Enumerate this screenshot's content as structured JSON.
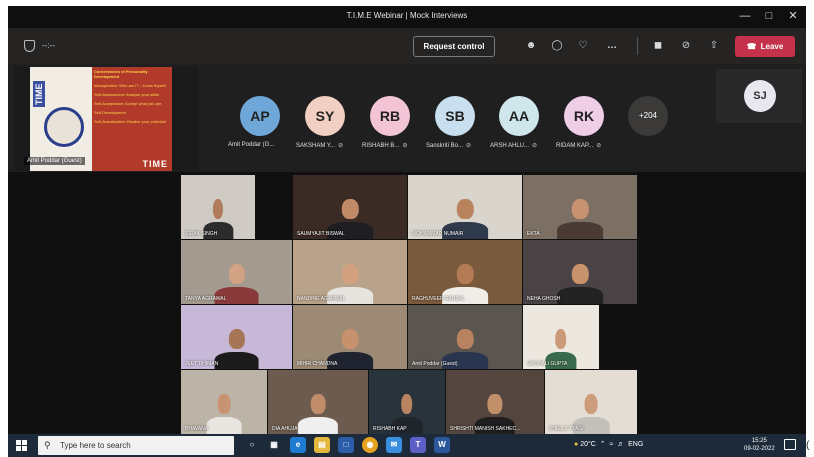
{
  "window": {
    "title": "T.I.M.E Webinar | Mock Interviews"
  },
  "toolbar": {
    "timer": "--:--",
    "request_control": "Request control",
    "leave": "Leave"
  },
  "shared_screen": {
    "owner": "Amit Poddar (Guest)",
    "side_text": "TIME",
    "brand": "TIME",
    "bullets": [
      "Cornerstones of Personality Development",
      "Introspection: Who am I? – Know thyself",
      "Self-Assessment: Analyse your skills",
      "Self-Acceptance: Accept what you are",
      "Self-Development",
      "Self-Actualisation: Realise your potential"
    ]
  },
  "participants": [
    {
      "initials": "AP",
      "name": "Amit Poddar (G...",
      "color": "#6fa8d8"
    },
    {
      "initials": "SY",
      "name": "SAKSHAM Y...",
      "color": "#f1cfc3"
    },
    {
      "initials": "RB",
      "name": "RISHABH B...",
      "color": "#f3c4d6"
    },
    {
      "initials": "SB",
      "name": "Sanskriti Bo...",
      "color": "#c8dff0"
    },
    {
      "initials": "AA",
      "name": "ARSH AHLU...",
      "color": "#cfe6ec"
    },
    {
      "initials": "RK",
      "name": "RIDAM KAP...",
      "color": "#f0cde6"
    }
  ],
  "overflow_count": "+204",
  "self_view": {
    "initials": "SJ"
  },
  "gallery": [
    {
      "name": "SIDAK SINGH",
      "bg": "#cfcac4",
      "skin": "#b07c5c",
      "cloth": "#2c2c2c"
    },
    {
      "name": "SAUMYAJIT BISWAL",
      "bg": "#3a2b24",
      "skin": "#c08a66",
      "cloth": "#1e1e22"
    },
    {
      "name": "MOHAMMAD NUMAIR",
      "bg": "#d9d4cc",
      "skin": "#b9835e",
      "cloth": "#2f3a4c"
    },
    {
      "name": "EKTA",
      "bg": "#7c6f63",
      "skin": "#c69272",
      "cloth": "#4a3b35"
    },
    {
      "name": "TANYA AGRAWAL",
      "bg": "#a49b90",
      "skin": "#d1a283",
      "cloth": "#8a3a3a"
    },
    {
      "name": "NANDINE AGARWAL",
      "bg": "#b8a28a",
      "skin": "#d3a080",
      "cloth": "#e7e4e0"
    },
    {
      "name": "RAGHUVEER SANSAL",
      "bg": "#7a5a3c",
      "skin": "#b27a55",
      "cloth": "#f0ede8"
    },
    {
      "name": "NEHA GHOSH",
      "bg": "#4a4346",
      "skin": "#c7926c",
      "cloth": "#222"
    },
    {
      "name": "JEET DHIMAN",
      "bg": "#c7b8d8",
      "skin": "#a67556",
      "cloth": "#1b1b1b"
    },
    {
      "name": "MIHIR CHANDNA",
      "bg": "#9c8a74",
      "skin": "#c6916c",
      "cloth": "#1f2430"
    },
    {
      "name": "Amit Poddar (Guest)",
      "bg": "#5b5550",
      "skin": "#b98261",
      "cloth": "#2a3550"
    },
    {
      "name": "VAISHALI GUPTA",
      "bg": "#ece8e0",
      "skin": "#cb9a78",
      "cloth": "#3a6a4c"
    },
    {
      "name": "BHAVANA",
      "bg": "#bdb4a8",
      "skin": "#c89370",
      "cloth": "#e9e5e0"
    },
    {
      "name": "DIA AHUJA",
      "bg": "#6c5b4e",
      "skin": "#c18c69",
      "cloth": "#efefef"
    },
    {
      "name": "RISHABH KAP",
      "bg": "#28333c",
      "skin": "#b8835f",
      "cloth": "#20252c"
    },
    {
      "name": "SHRISHTI MANISH SAKHEC...",
      "bg": "#54463e",
      "skin": "#c28f6b",
      "cloth": "#1e1e1e"
    },
    {
      "name": "SHELLY TYAGI",
      "bg": "#e4ddd3",
      "skin": "#cd9c7a",
      "cloth": "#c3c0ba"
    }
  ],
  "taskbar": {
    "search_placeholder": "Type here to search",
    "weather": "20°C",
    "language": "ENG",
    "time": "15:25",
    "date": "09-02-2022"
  }
}
